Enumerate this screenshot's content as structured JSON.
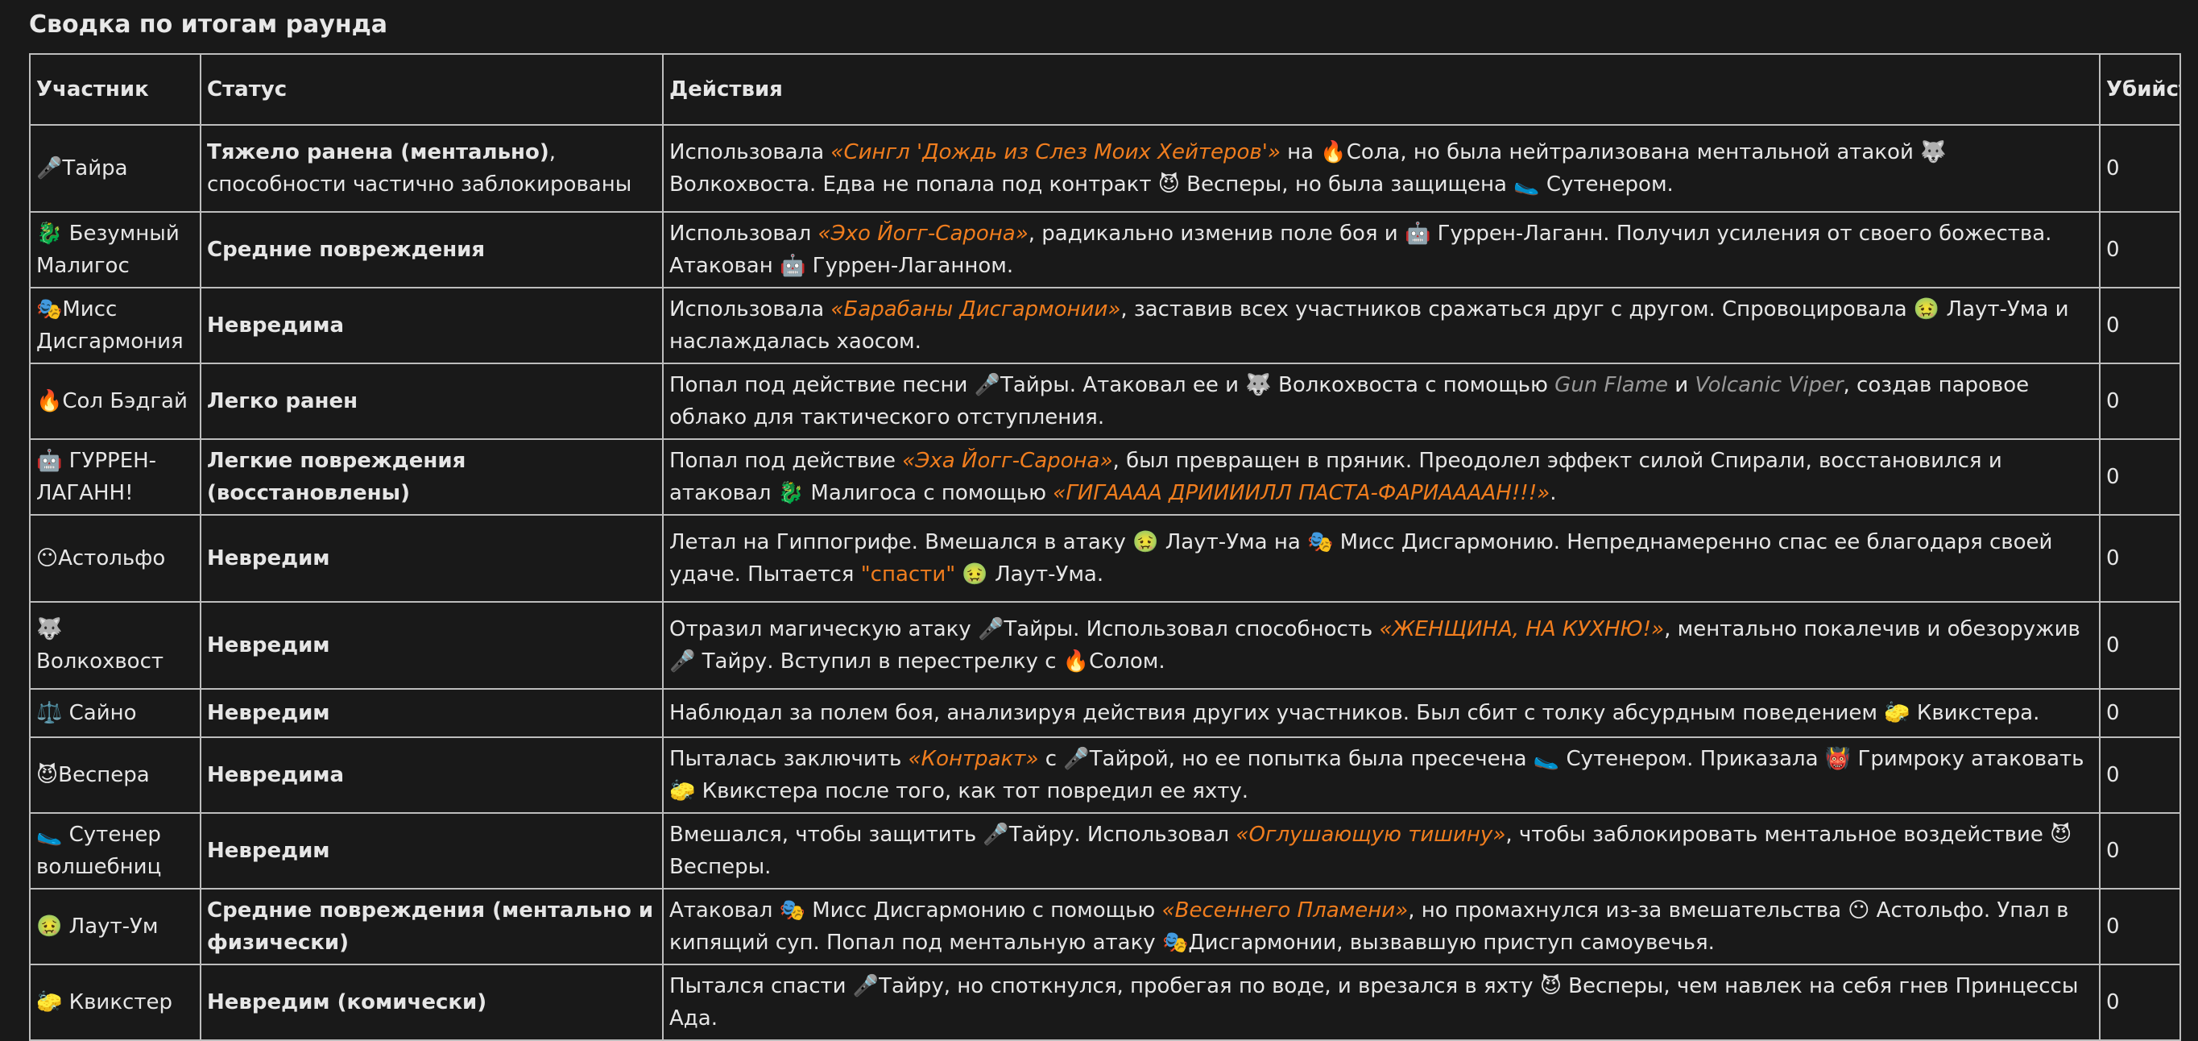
{
  "title": "Сводка по итогам раунда",
  "columns": [
    "Участник",
    "Статус",
    "Действия",
    "Убийства"
  ],
  "rows": [
    {
      "name": "🎤Тайра",
      "status_parts": [
        {
          "t": "Тяжело ранена (ментально)",
          "b": true
        },
        {
          "t": ", способности частично заблокированы",
          "b": false
        }
      ],
      "actions": [
        {
          "t": "Использовала "
        },
        {
          "t": "«Сингл 'Дождь из Слез Моих Хейтеров'»",
          "s": "hl"
        },
        {
          "t": " на 🔥Сола, но была нейтрализована ментальной атакой 🐺 Волкохвоста. Едва не попала под контракт 😈 Весперы, но была защищена 🥿 Сутенером."
        }
      ],
      "kills": "0"
    },
    {
      "name": "🐉 Безумный Малигос",
      "status_parts": [
        {
          "t": "Средние повреждения",
          "b": true
        }
      ],
      "actions": [
        {
          "t": "Использовал "
        },
        {
          "t": "«Эхо Йогг-Сарона»",
          "s": "hl"
        },
        {
          "t": ", радикально изменив поле боя и 🤖 Гуррен-Лаганн. Получил усиления от своего божества. Атакован 🤖 Гуррен-Лаганном."
        }
      ],
      "kills": "0"
    },
    {
      "name": "🎭Мисс Дисгармония",
      "status_parts": [
        {
          "t": "Невредима",
          "b": true
        }
      ],
      "actions": [
        {
          "t": "Использовала "
        },
        {
          "t": "«Барабаны Дисгармонии»",
          "s": "hl"
        },
        {
          "t": ", заставив всех участников сражаться друг с другом. Спровоцировала 🤢 Лаут-Ума и наслаждалась хаосом."
        }
      ],
      "kills": "0"
    },
    {
      "name": "🔥Сол Бэдгай",
      "status_parts": [
        {
          "t": "Легко ранен",
          "b": true
        }
      ],
      "actions": [
        {
          "t": "Попал под действие песни 🎤Тайры. Атаковал ее и 🐺 Волкохвоста с помощью "
        },
        {
          "t": "Gun Flame",
          "s": "gray"
        },
        {
          "t": " и "
        },
        {
          "t": "Volcanic Viper",
          "s": "gray"
        },
        {
          "t": ", создав паровое облако для тактического отступления."
        }
      ],
      "kills": "0"
    },
    {
      "name": "🤖 ГУРРЕН-ЛАГАНН!",
      "status_parts": [
        {
          "t": "Легкие повреждения (восстановлены)",
          "b": true
        }
      ],
      "actions": [
        {
          "t": "Попал под действие "
        },
        {
          "t": "«Эха Йогг-Сарона»",
          "s": "hl"
        },
        {
          "t": ", был превращен в пряник. Преодолел эффект силой Спирали, восстановился и атаковал 🐉 Малигоса с помощью "
        },
        {
          "t": "«ГИГАААА ДРИИИИЛЛ ПАСТА-ФАРИААААН!!!»",
          "s": "hl"
        },
        {
          "t": "."
        }
      ],
      "kills": "0"
    },
    {
      "name": "😶Астольфо",
      "status_parts": [
        {
          "t": "Невредим",
          "b": true
        }
      ],
      "actions": [
        {
          "t": "Летал на Гиппогрифе. Вмешался в атаку 🤢 Лаут-Ума на 🎭 Мисс Дисгармонию. Непреднамеренно спас ее благодаря своей удаче. Пытается "
        },
        {
          "t": "\"спасти\"",
          "s": "hl-q"
        },
        {
          "t": " 🤢 Лаут-Ума."
        }
      ],
      "kills": "0"
    },
    {
      "name": "🐺 Волкохвост",
      "status_parts": [
        {
          "t": "Невредим",
          "b": true
        }
      ],
      "actions": [
        {
          "t": "Отразил магическую атаку 🎤Тайры. Использовал способность "
        },
        {
          "t": "«ЖЕНЩИНА, НА КУХНЮ!»",
          "s": "hl"
        },
        {
          "t": ", ментально покалечив и обезоружив 🎤 Тайру. Вступил в перестрелку с 🔥Солом."
        }
      ],
      "kills": "0"
    },
    {
      "name": "⚖️ Сайно",
      "status_parts": [
        {
          "t": "Невредим",
          "b": true
        }
      ],
      "actions": [
        {
          "t": "Наблюдал за полем боя, анализируя действия других участников. Был сбит с толку абсурдным поведением 🧽 Квикстера."
        }
      ],
      "kills": "0"
    },
    {
      "name": "😈Веспера",
      "status_parts": [
        {
          "t": "Невредима",
          "b": true
        }
      ],
      "actions": [
        {
          "t": "Пыталась заключить "
        },
        {
          "t": "«Контракт»",
          "s": "hl"
        },
        {
          "t": " с 🎤Тайрой, но ее попытка была пресечена 🥿 Сутенером. Приказала 👹 Гримроку атаковать 🧽 Квикстера после того, как тот повредил ее яхту."
        }
      ],
      "kills": "0"
    },
    {
      "name": "🥿 Сутенер волшебниц",
      "status_parts": [
        {
          "t": "Невредим",
          "b": true
        }
      ],
      "actions": [
        {
          "t": "Вмешался, чтобы защитить 🎤Тайру. Использовал "
        },
        {
          "t": "«Оглушающую тишину»",
          "s": "hl"
        },
        {
          "t": ", чтобы заблокировать ментальное воздействие 😈 Весперы."
        }
      ],
      "kills": "0"
    },
    {
      "name": "🤢 Лаут-Ум",
      "status_parts": [
        {
          "t": "Средние повреждения (ментально и физически)",
          "b": true
        }
      ],
      "actions": [
        {
          "t": "Атаковал 🎭 Мисс Дисгармонию с помощью "
        },
        {
          "t": "«Весеннего Пламени»",
          "s": "hl"
        },
        {
          "t": ", но промахнулся из-за вмешательства 😶 Астольфо. Упал в кипящий суп. Попал под ментальную атаку 🎭Дисгармонии, вызвавшую приступ самоувечья."
        }
      ],
      "kills": "0"
    },
    {
      "name": "🧽 Квикстер",
      "status_parts": [
        {
          "t": "Невредим (комически)",
          "b": true
        }
      ],
      "actions": [
        {
          "t": "Пытался спасти 🎤Тайру, но споткнулся, пробегая по воде, и врезался в яхту 😈 Весперы, чем навлек на себя гнев Принцессы Ада."
        }
      ],
      "kills": "0"
    }
  ]
}
